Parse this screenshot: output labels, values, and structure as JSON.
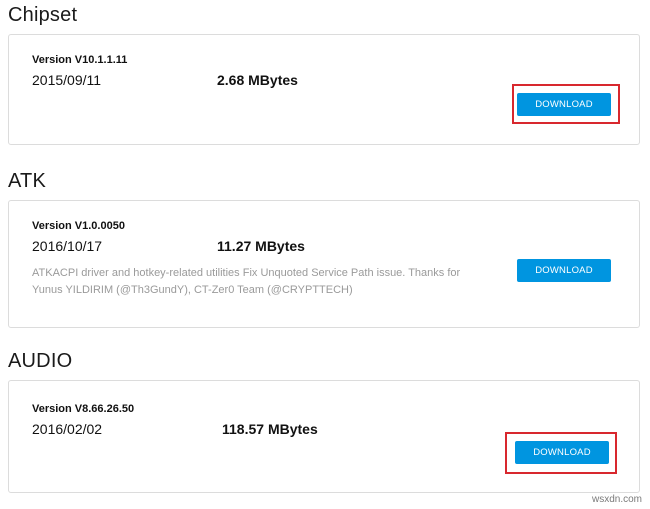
{
  "sections": [
    {
      "title": "Chipset",
      "version": "Version V10.1.1.11",
      "date": "2015/09/11",
      "size": "2.68 MBytes",
      "description": "",
      "button_label": "DOWNLOAD",
      "highlighted": true
    },
    {
      "title": "ATK",
      "version": "Version V1.0.0050",
      "date": "2016/10/17",
      "size": "11.27 MBytes",
      "description": "ATKACPI driver and hotkey-related utilities Fix Unquoted Service Path issue. Thanks for Yunus YILDIRIM (@Th3GundY), CT-Zer0 Team (@CRYPTTECH)",
      "button_label": "DOWNLOAD",
      "highlighted": false
    },
    {
      "title": "AUDIO",
      "version": "Version V8.66.26.50",
      "date": "2016/02/02",
      "size": "118.57 MBytes",
      "description": "",
      "button_label": "DOWNLOAD",
      "highlighted": true
    }
  ],
  "watermark": "wsxdn.com",
  "colors": {
    "button": "#0095e0",
    "highlight": "#d8282e",
    "description": "#9a9a9a",
    "border": "#dcdcdc"
  }
}
